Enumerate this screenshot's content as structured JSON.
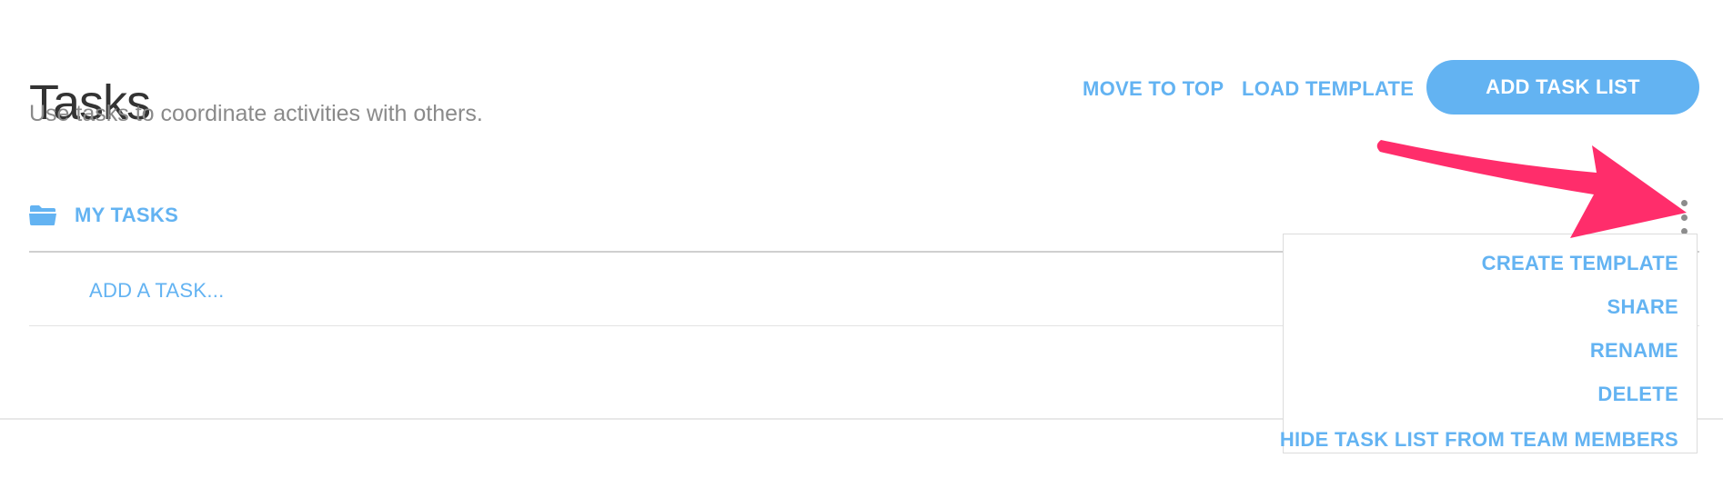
{
  "header": {
    "title": "Tasks",
    "subtitle": "Use tasks to coordinate activities with others.",
    "move_to_top_label": "MOVE TO TOP",
    "load_template_label": "LOAD TEMPLATE",
    "add_task_list_label": "ADD TASK LIST"
  },
  "task_list": {
    "name": "MY TASKS",
    "icon": "folder-icon",
    "options_icon": "more-vertical-icon",
    "add_task_placeholder": "ADD A TASK..."
  },
  "options_menu": {
    "items": [
      {
        "label": "CREATE TEMPLATE"
      },
      {
        "label": "SHARE"
      },
      {
        "label": "RENAME"
      },
      {
        "label": "DELETE"
      },
      {
        "label": "HIDE TASK LIST FROM TEAM MEMBERS"
      }
    ]
  },
  "annotation": {
    "icon": "pointer-arrow-icon",
    "color": "#ff2d6b"
  },
  "colors": {
    "accent": "#63b3f2",
    "title": "#333333",
    "subtitle": "#8a8a8a",
    "annotation_arrow": "#ff2d6b"
  }
}
